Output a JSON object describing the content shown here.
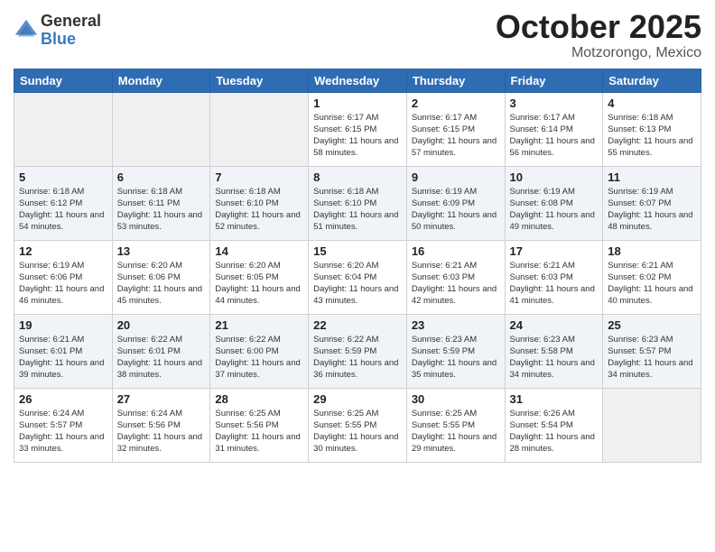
{
  "header": {
    "logo_general": "General",
    "logo_blue": "Blue",
    "month": "October 2025",
    "location": "Motzorongo, Mexico"
  },
  "weekdays": [
    "Sunday",
    "Monday",
    "Tuesday",
    "Wednesday",
    "Thursday",
    "Friday",
    "Saturday"
  ],
  "weeks": [
    [
      {
        "day": "",
        "sunrise": "",
        "sunset": "",
        "daylight": ""
      },
      {
        "day": "",
        "sunrise": "",
        "sunset": "",
        "daylight": ""
      },
      {
        "day": "",
        "sunrise": "",
        "sunset": "",
        "daylight": ""
      },
      {
        "day": "1",
        "sunrise": "Sunrise: 6:17 AM",
        "sunset": "Sunset: 6:15 PM",
        "daylight": "Daylight: 11 hours and 58 minutes."
      },
      {
        "day": "2",
        "sunrise": "Sunrise: 6:17 AM",
        "sunset": "Sunset: 6:15 PM",
        "daylight": "Daylight: 11 hours and 57 minutes."
      },
      {
        "day": "3",
        "sunrise": "Sunrise: 6:17 AM",
        "sunset": "Sunset: 6:14 PM",
        "daylight": "Daylight: 11 hours and 56 minutes."
      },
      {
        "day": "4",
        "sunrise": "Sunrise: 6:18 AM",
        "sunset": "Sunset: 6:13 PM",
        "daylight": "Daylight: 11 hours and 55 minutes."
      }
    ],
    [
      {
        "day": "5",
        "sunrise": "Sunrise: 6:18 AM",
        "sunset": "Sunset: 6:12 PM",
        "daylight": "Daylight: 11 hours and 54 minutes."
      },
      {
        "day": "6",
        "sunrise": "Sunrise: 6:18 AM",
        "sunset": "Sunset: 6:11 PM",
        "daylight": "Daylight: 11 hours and 53 minutes."
      },
      {
        "day": "7",
        "sunrise": "Sunrise: 6:18 AM",
        "sunset": "Sunset: 6:10 PM",
        "daylight": "Daylight: 11 hours and 52 minutes."
      },
      {
        "day": "8",
        "sunrise": "Sunrise: 6:18 AM",
        "sunset": "Sunset: 6:10 PM",
        "daylight": "Daylight: 11 hours and 51 minutes."
      },
      {
        "day": "9",
        "sunrise": "Sunrise: 6:19 AM",
        "sunset": "Sunset: 6:09 PM",
        "daylight": "Daylight: 11 hours and 50 minutes."
      },
      {
        "day": "10",
        "sunrise": "Sunrise: 6:19 AM",
        "sunset": "Sunset: 6:08 PM",
        "daylight": "Daylight: 11 hours and 49 minutes."
      },
      {
        "day": "11",
        "sunrise": "Sunrise: 6:19 AM",
        "sunset": "Sunset: 6:07 PM",
        "daylight": "Daylight: 11 hours and 48 minutes."
      }
    ],
    [
      {
        "day": "12",
        "sunrise": "Sunrise: 6:19 AM",
        "sunset": "Sunset: 6:06 PM",
        "daylight": "Daylight: 11 hours and 46 minutes."
      },
      {
        "day": "13",
        "sunrise": "Sunrise: 6:20 AM",
        "sunset": "Sunset: 6:06 PM",
        "daylight": "Daylight: 11 hours and 45 minutes."
      },
      {
        "day": "14",
        "sunrise": "Sunrise: 6:20 AM",
        "sunset": "Sunset: 6:05 PM",
        "daylight": "Daylight: 11 hours and 44 minutes."
      },
      {
        "day": "15",
        "sunrise": "Sunrise: 6:20 AM",
        "sunset": "Sunset: 6:04 PM",
        "daylight": "Daylight: 11 hours and 43 minutes."
      },
      {
        "day": "16",
        "sunrise": "Sunrise: 6:21 AM",
        "sunset": "Sunset: 6:03 PM",
        "daylight": "Daylight: 11 hours and 42 minutes."
      },
      {
        "day": "17",
        "sunrise": "Sunrise: 6:21 AM",
        "sunset": "Sunset: 6:03 PM",
        "daylight": "Daylight: 11 hours and 41 minutes."
      },
      {
        "day": "18",
        "sunrise": "Sunrise: 6:21 AM",
        "sunset": "Sunset: 6:02 PM",
        "daylight": "Daylight: 11 hours and 40 minutes."
      }
    ],
    [
      {
        "day": "19",
        "sunrise": "Sunrise: 6:21 AM",
        "sunset": "Sunset: 6:01 PM",
        "daylight": "Daylight: 11 hours and 39 minutes."
      },
      {
        "day": "20",
        "sunrise": "Sunrise: 6:22 AM",
        "sunset": "Sunset: 6:01 PM",
        "daylight": "Daylight: 11 hours and 38 minutes."
      },
      {
        "day": "21",
        "sunrise": "Sunrise: 6:22 AM",
        "sunset": "Sunset: 6:00 PM",
        "daylight": "Daylight: 11 hours and 37 minutes."
      },
      {
        "day": "22",
        "sunrise": "Sunrise: 6:22 AM",
        "sunset": "Sunset: 5:59 PM",
        "daylight": "Daylight: 11 hours and 36 minutes."
      },
      {
        "day": "23",
        "sunrise": "Sunrise: 6:23 AM",
        "sunset": "Sunset: 5:59 PM",
        "daylight": "Daylight: 11 hours and 35 minutes."
      },
      {
        "day": "24",
        "sunrise": "Sunrise: 6:23 AM",
        "sunset": "Sunset: 5:58 PM",
        "daylight": "Daylight: 11 hours and 34 minutes."
      },
      {
        "day": "25",
        "sunrise": "Sunrise: 6:23 AM",
        "sunset": "Sunset: 5:57 PM",
        "daylight": "Daylight: 11 hours and 34 minutes."
      }
    ],
    [
      {
        "day": "26",
        "sunrise": "Sunrise: 6:24 AM",
        "sunset": "Sunset: 5:57 PM",
        "daylight": "Daylight: 11 hours and 33 minutes."
      },
      {
        "day": "27",
        "sunrise": "Sunrise: 6:24 AM",
        "sunset": "Sunset: 5:56 PM",
        "daylight": "Daylight: 11 hours and 32 minutes."
      },
      {
        "day": "28",
        "sunrise": "Sunrise: 6:25 AM",
        "sunset": "Sunset: 5:56 PM",
        "daylight": "Daylight: 11 hours and 31 minutes."
      },
      {
        "day": "29",
        "sunrise": "Sunrise: 6:25 AM",
        "sunset": "Sunset: 5:55 PM",
        "daylight": "Daylight: 11 hours and 30 minutes."
      },
      {
        "day": "30",
        "sunrise": "Sunrise: 6:25 AM",
        "sunset": "Sunset: 5:55 PM",
        "daylight": "Daylight: 11 hours and 29 minutes."
      },
      {
        "day": "31",
        "sunrise": "Sunrise: 6:26 AM",
        "sunset": "Sunset: 5:54 PM",
        "daylight": "Daylight: 11 hours and 28 minutes."
      },
      {
        "day": "",
        "sunrise": "",
        "sunset": "",
        "daylight": ""
      }
    ]
  ]
}
